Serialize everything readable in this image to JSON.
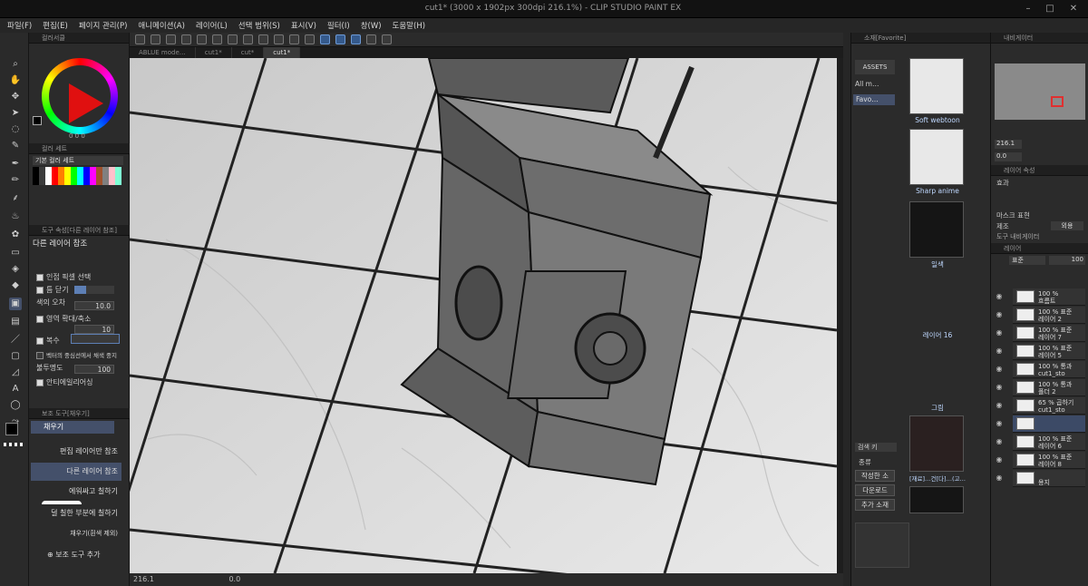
{
  "window": {
    "title": "cut1* (3000 x 1902px 300dpi 216.1%) - CLIP STUDIO PAINT EX",
    "controls": [
      "–",
      "□",
      "✕"
    ]
  },
  "menu": [
    "파일(F)",
    "편집(E)",
    "페이지 관리(P)",
    "애니메이션(A)",
    "레이어(L)",
    "선택 범위(S)",
    "표시(V)",
    "필터(I)",
    "창(W)",
    "도움말(H)"
  ],
  "tabs": [
    {
      "label": "ABLUE mode…",
      "active": false
    },
    {
      "label": "cut1*",
      "active": false
    },
    {
      "label": "cut*",
      "active": false
    },
    {
      "label": "cut1*",
      "active": true
    }
  ],
  "left": {
    "color_wheel_header": "컬러서클",
    "color_set_header": "컬러 세트",
    "color_set_name": "기본 컬러 세트",
    "hsv_value": "0  0  0",
    "swatch_colors": [
      "#000000",
      "#3b3b3b",
      "#ffffff",
      "#ff0000",
      "#ff7f00",
      "#ffff00",
      "#00ff00",
      "#00ffff",
      "#0000ff",
      "#ff00ff",
      "#a0522d",
      "#808080",
      "#ffc0cb",
      "#7fffd4"
    ],
    "tool_property_header": "도구 속성[다른 레이어 참조]",
    "tool_name": "다른 레이어 참조",
    "props": [
      {
        "label": "인접 픽셀 선택",
        "checked": true
      },
      {
        "label": "틈 닫기",
        "checked": true
      },
      {
        "label": "색의 오차",
        "value": "10.0"
      },
      {
        "label": "영역 확대/축소",
        "value": "10",
        "checked": true
      },
      {
        "label": "복수",
        "checked": true
      },
      {
        "label": "벡터의 중심선에서 채색 중지",
        "checked": false
      },
      {
        "label": "불투명도",
        "value": "100"
      },
      {
        "label": "안티에일리어싱",
        "checked": true
      }
    ],
    "subtool_header": "보조 도구[채우기]",
    "subtool_group": "채우기",
    "subtools": [
      {
        "label": "편집 레이어만 참조",
        "selected": false
      },
      {
        "label": "다른 레이어 참조",
        "selected": true
      },
      {
        "label": "에워싸고 칠하기",
        "selected": false
      },
      {
        "label": "덜 칠한 부분에 칠하기",
        "selected": false
      },
      {
        "label": "채우기(흰색 제외)",
        "selected": false
      }
    ],
    "add_subtool": "보조 도구 추가"
  },
  "status": {
    "zoom": "216.1",
    "angle": "0.0"
  },
  "material": {
    "header": "소재[Favorite]",
    "brand": "ASSETS",
    "tree": [
      "All m…",
      "Favo…"
    ],
    "items": [
      {
        "label": "Soft webtoon",
        "dark": false
      },
      {
        "label": "Sharp anime",
        "dark": false
      },
      {
        "label": "일색",
        "dark": true
      },
      {
        "label": "레이어 16",
        "dark": true
      },
      {
        "label": "그림",
        "dark": true
      },
      {
        "label": "[재료]…건[다]…(고…",
        "dark": false
      }
    ],
    "search_header": "검색 키",
    "search_rows": [
      "종류",
      "작성한 소",
      "다운로드",
      "추가 소재"
    ]
  },
  "right": {
    "navigator_header": "내비게이터",
    "nav_zoom": "216.1",
    "nav_angle": "0.0",
    "layer_prop_header": "레이어 속성",
    "effect_label": "효과",
    "mask_label": "마스크 표현",
    "display_label": "제조",
    "display_value": "외용",
    "tool_navigator": "도구 내비게이터",
    "layer_header": "레이어",
    "blend_mode": "표준",
    "opacity": "100",
    "layers": [
      {
        "pct": "100 %",
        "name": "흐름트",
        "selected": false
      },
      {
        "pct": "100 % 표준",
        "name": "레이어 2",
        "selected": false
      },
      {
        "pct": "100 % 표준",
        "name": "레이어 7",
        "selected": false
      },
      {
        "pct": "100 % 표준",
        "name": "레이어 5",
        "selected": false
      },
      {
        "pct": "100 % 통과",
        "name": "cut1_sto",
        "selected": false
      },
      {
        "pct": "100 % 통과",
        "name": "폴더 2",
        "selected": false
      },
      {
        "pct": "65 % 곱하기",
        "name": "cut1_sto",
        "selected": false
      },
      {
        "pct": "",
        "name": "",
        "selected": true
      },
      {
        "pct": "100 % 표준",
        "name": "레이어 6",
        "selected": false
      },
      {
        "pct": "100 % 표준",
        "name": "레이어 8",
        "selected": false
      },
      {
        "pct": "",
        "name": "용지",
        "selected": false
      }
    ]
  }
}
